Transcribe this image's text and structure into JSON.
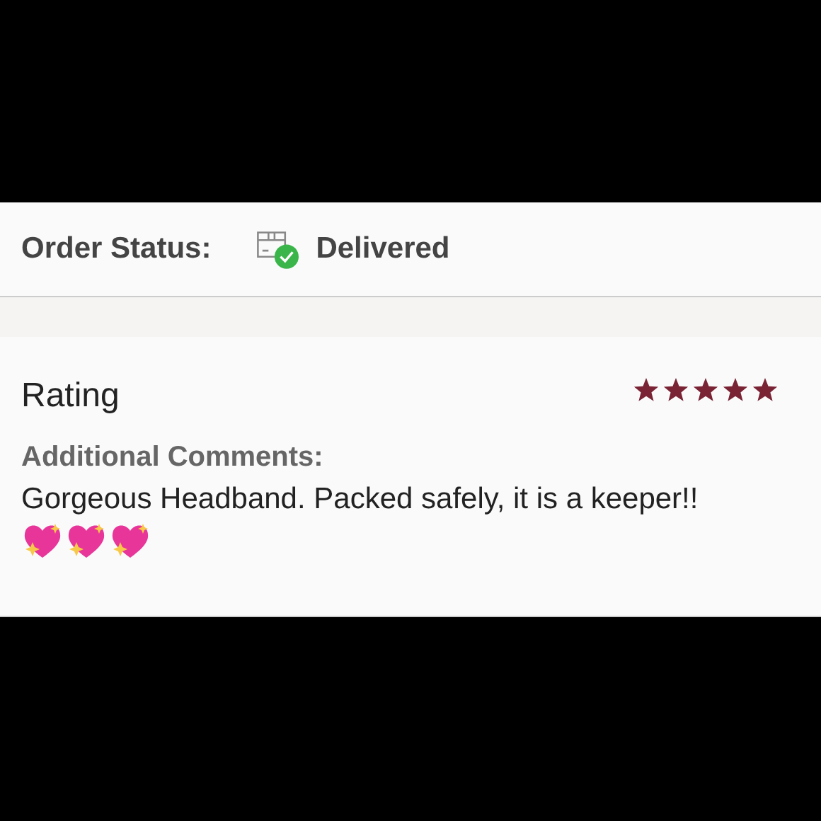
{
  "order_status": {
    "label": "Order Status:",
    "status": "Delivered",
    "delivered": true
  },
  "review": {
    "title": "Rating",
    "stars": 5,
    "comments_label": "Additional Comments:",
    "comment": "Gorgeous Headband. Packed safely, it is a keeper!!",
    "emojis": [
      {
        "kind": "sparkling-heart"
      },
      {
        "kind": "sparkling-heart"
      },
      {
        "kind": "sparkling-heart"
      }
    ]
  }
}
